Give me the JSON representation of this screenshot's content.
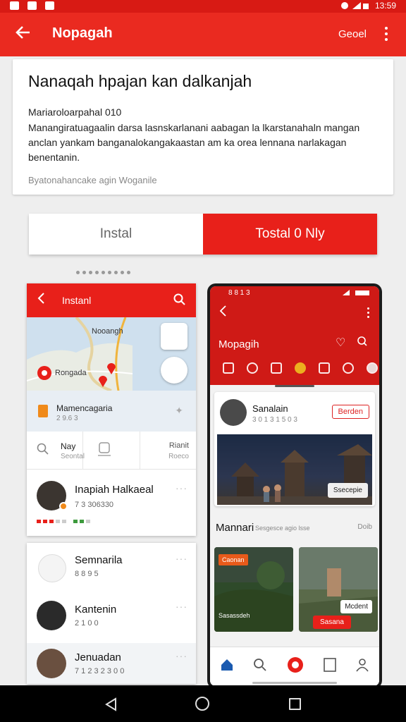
{
  "status_bar": {
    "time": "13:59"
  },
  "app_bar": {
    "title": "Nopagah",
    "action": "Geoel"
  },
  "info_card": {
    "title": "Nanaqah hpajan kan dalkanjah",
    "subtitle": "Mariaroloarpahal 010",
    "body": "Manangiratuagaalin darsa lasnskarlanani aabagan la lkarstanahaln mangan anclan yankam banganalokangakaastan am ka orea lennana narlakagan benentanin.",
    "footer": "Byatonahancake agin Woganile"
  },
  "toggle": {
    "option_a": "Instal",
    "option_b": "Tostal 0 Nly"
  },
  "left_panel": {
    "bar_title": "Instanl",
    "map": {
      "label_top": "Nooangh",
      "label_pin": "Rongada"
    },
    "place": {
      "title": "Mamencagaria",
      "sub": "2 9.6 3"
    },
    "quick": {
      "a_label": "Nay",
      "a_sub": "Seontal",
      "c_label": "Rianit",
      "c_sub": "Roeco"
    },
    "first_person": {
      "name": "Inapiah Halkaeal",
      "meta": "7 3 306330"
    }
  },
  "people": [
    {
      "name": "Semnarila",
      "meta": "8 8 9 5"
    },
    {
      "name": "Kantenin",
      "meta": "2 1 0 0"
    },
    {
      "name": "Jenuadan",
      "meta": "7 1 2 3 2 3 0 0"
    }
  ],
  "phone": {
    "status": "8 8 1 3",
    "title": "Mopagih",
    "user": {
      "name": "Sanalain",
      "sub": "3 0 1 3 1 5 0 3",
      "follow": "Berden"
    },
    "photo_button": "Ssecepie",
    "section": {
      "title": "Mannari",
      "sub": "Sesgesce agio lsse",
      "more": "Doib"
    },
    "tile_tag": "Caonan",
    "tile_caption": "Sasassdeh",
    "tile_btn": "Mcdent",
    "tile_red": "Sasana"
  },
  "colors": {
    "brand_red": "#e8201a",
    "dark_red": "#cf1a16",
    "bg": "#eeeeee"
  },
  "icons": [
    "arrow-left-icon",
    "more-vert-icon",
    "search-icon",
    "share-icon",
    "heart-icon",
    "home-icon",
    "nav-back-icon",
    "nav-home-icon",
    "nav-recents-icon"
  ]
}
